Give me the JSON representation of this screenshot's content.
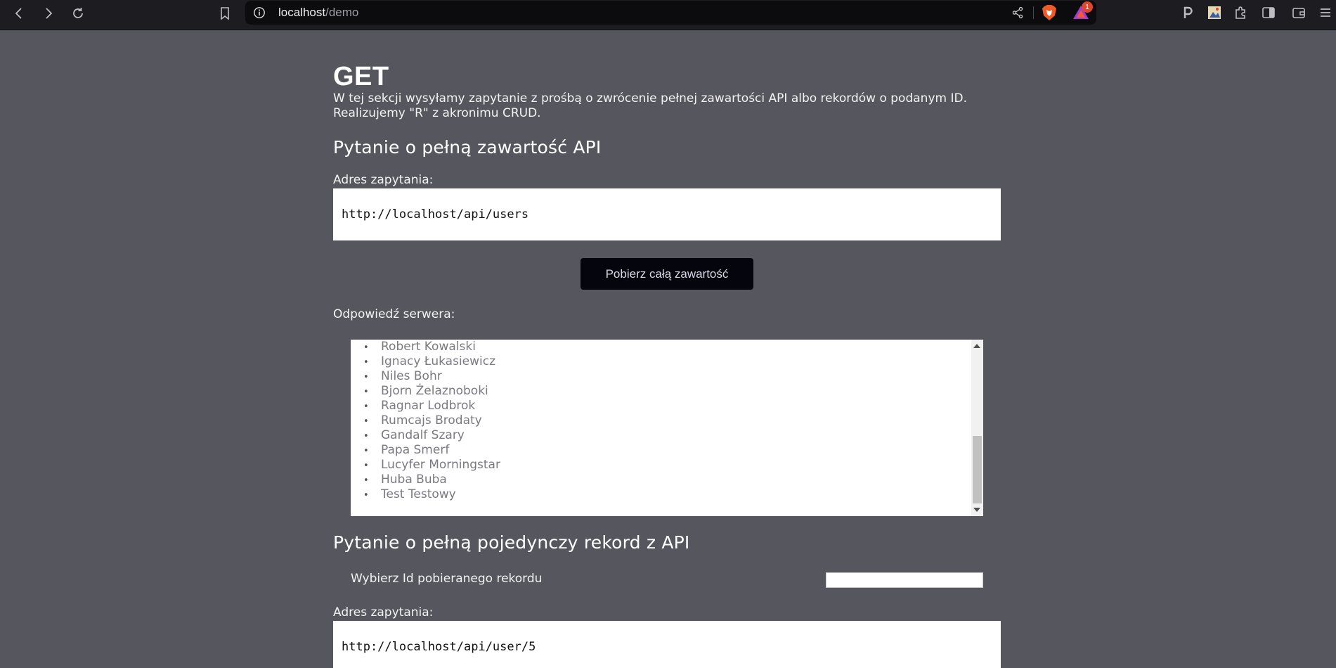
{
  "browser": {
    "url_host": "localhost",
    "url_path": "/demo",
    "rewards_count": "1"
  },
  "page": {
    "heading": "GET",
    "intro": "W tej sekcji wysyłamy zapytanie z prośbą o zwrócenie pełnej zawartości API albo rekordów o podanym ID. Realizujemy \"R\" z akronimu CRUD.",
    "section_all": {
      "title": "Pytanie o pełną zawartość API",
      "address_label": "Adres zapytania:",
      "address": "http://localhost/api/users",
      "button": "Pobierz całą zawartość",
      "response_label": "Odpowiedź serwera:",
      "response_items": [
        "Robert Kowalski",
        "Ignacy Łukasiewicz",
        "Niles Bohr",
        "Bjorn Żelaznoboki",
        "Ragnar Lodbrok",
        "Rumcajs Brodaty",
        "Gandalf Szary",
        "Papa Smerf",
        "Lucyfer Morningstar",
        "Huba Buba",
        "Test Testowy"
      ]
    },
    "section_single": {
      "title": "Pytanie o pełną pojedynczy rekord z API",
      "pick_label": "Wybierz Id pobieranego rekordu",
      "id_value": "",
      "address_label": "Adres zapytania:",
      "address": "http://localhost/api/user/5"
    }
  }
}
